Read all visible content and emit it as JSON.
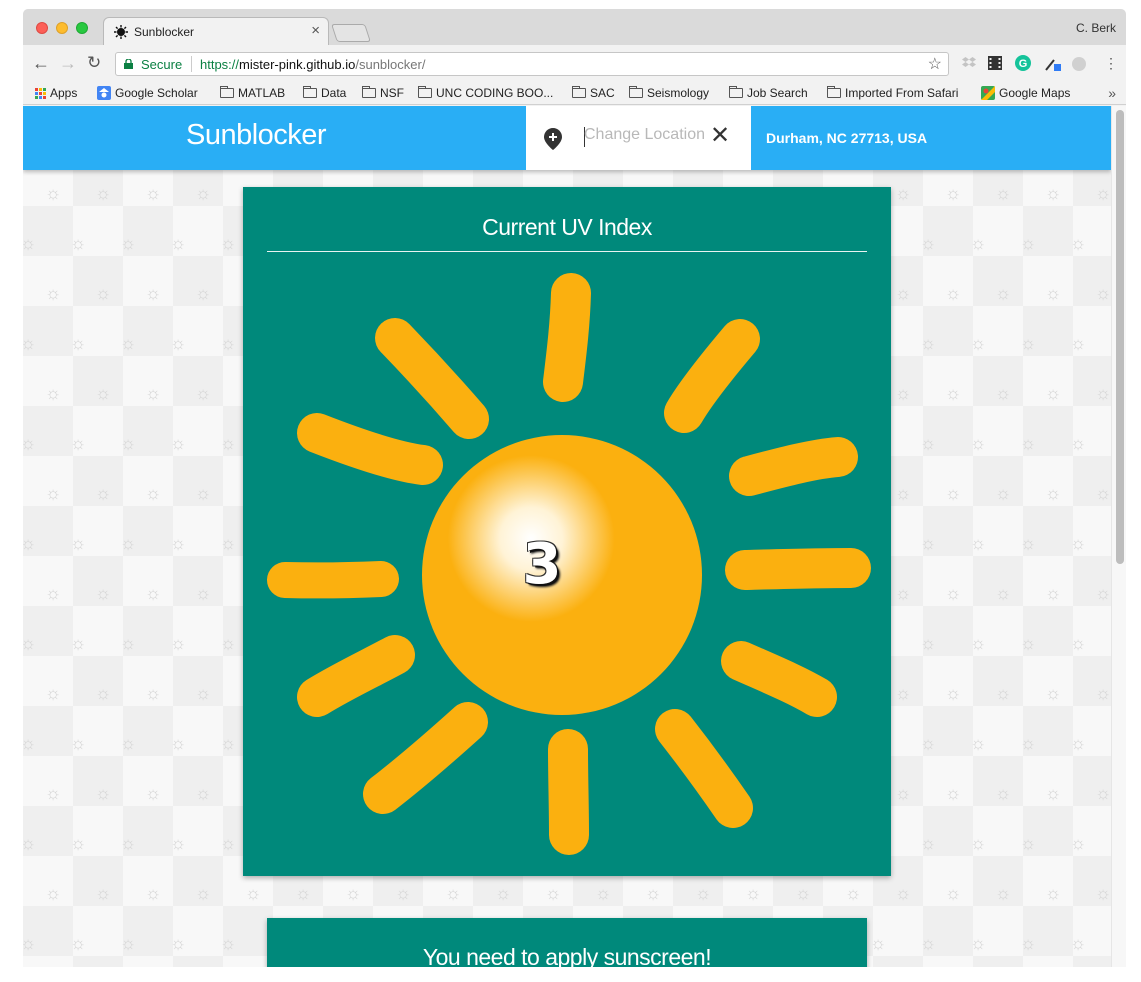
{
  "browser": {
    "tab_title": "Sunblocker",
    "tab_close": "×",
    "profile_name": "C. Berk",
    "secure_label": "Secure",
    "url_scheme": "https://",
    "url_host": "mister-pink.github.io",
    "url_path": "/sunblocker/",
    "bookmarks": [
      {
        "label": "Apps",
        "icon": "apps-grid-icon"
      },
      {
        "label": "Google Scholar",
        "icon": "scholar-icon"
      },
      {
        "label": "MATLAB",
        "icon": "folder-icon"
      },
      {
        "label": "Data",
        "icon": "folder-icon"
      },
      {
        "label": "NSF",
        "icon": "folder-icon"
      },
      {
        "label": "UNC CODING BOO...",
        "icon": "folder-icon"
      },
      {
        "label": "SAC",
        "icon": "folder-icon"
      },
      {
        "label": "Seismology",
        "icon": "folder-icon"
      },
      {
        "label": "Job Search",
        "icon": "folder-icon"
      },
      {
        "label": "Imported From Safari",
        "icon": "folder-icon"
      },
      {
        "label": "Google Maps",
        "icon": "maps-icon"
      }
    ]
  },
  "app": {
    "brand": "Sunblocker",
    "location_input": {
      "placeholder": "Change Location",
      "value": ""
    },
    "current_location": "Durham, NC 27713, USA"
  },
  "uv_card": {
    "title": "Current UV Index",
    "uv_index": "3"
  },
  "advice_card": {
    "title": "You need to apply sunscreen!"
  },
  "colors": {
    "app_bar": "#29aef5",
    "card": "#00897b",
    "sun": "#fbb00f"
  }
}
